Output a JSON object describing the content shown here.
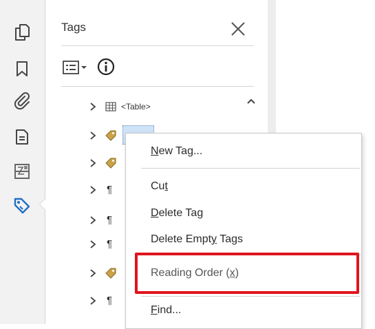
{
  "panel": {
    "title": "Tags"
  },
  "tree": {
    "table_tag": "<Table>",
    "selected_tag_fragment": "..."
  },
  "context_menu": {
    "new_tag": {
      "before": "",
      "key": "N",
      "after": "ew Tag..."
    },
    "cut": {
      "before": "Cu",
      "key": "t",
      "after": ""
    },
    "delete_tag": {
      "before": "",
      "key": "D",
      "after": "elete Tag"
    },
    "delete_empty_tags": {
      "before": "Delete Empt",
      "key": "y",
      "after": " Tags"
    },
    "reading_order": {
      "before": "Reading Order (",
      "key": "x",
      "after": ")"
    },
    "find": {
      "before": "",
      "key": "F",
      "after": "ind..."
    }
  },
  "colors": {
    "highlight": "#e0141e",
    "tag_icon": "#c9a24a",
    "active_tool": "#1f6fc4"
  },
  "icons": [
    "pages-icon",
    "bookmark-icon",
    "attachment-icon",
    "document-properties-icon",
    "content-icon",
    "tags-icon",
    "close-icon",
    "options-menu-icon",
    "info-icon",
    "chevron-right-icon",
    "table-icon",
    "tag-icon",
    "paragraph-icon",
    "scroll-up-icon"
  ]
}
